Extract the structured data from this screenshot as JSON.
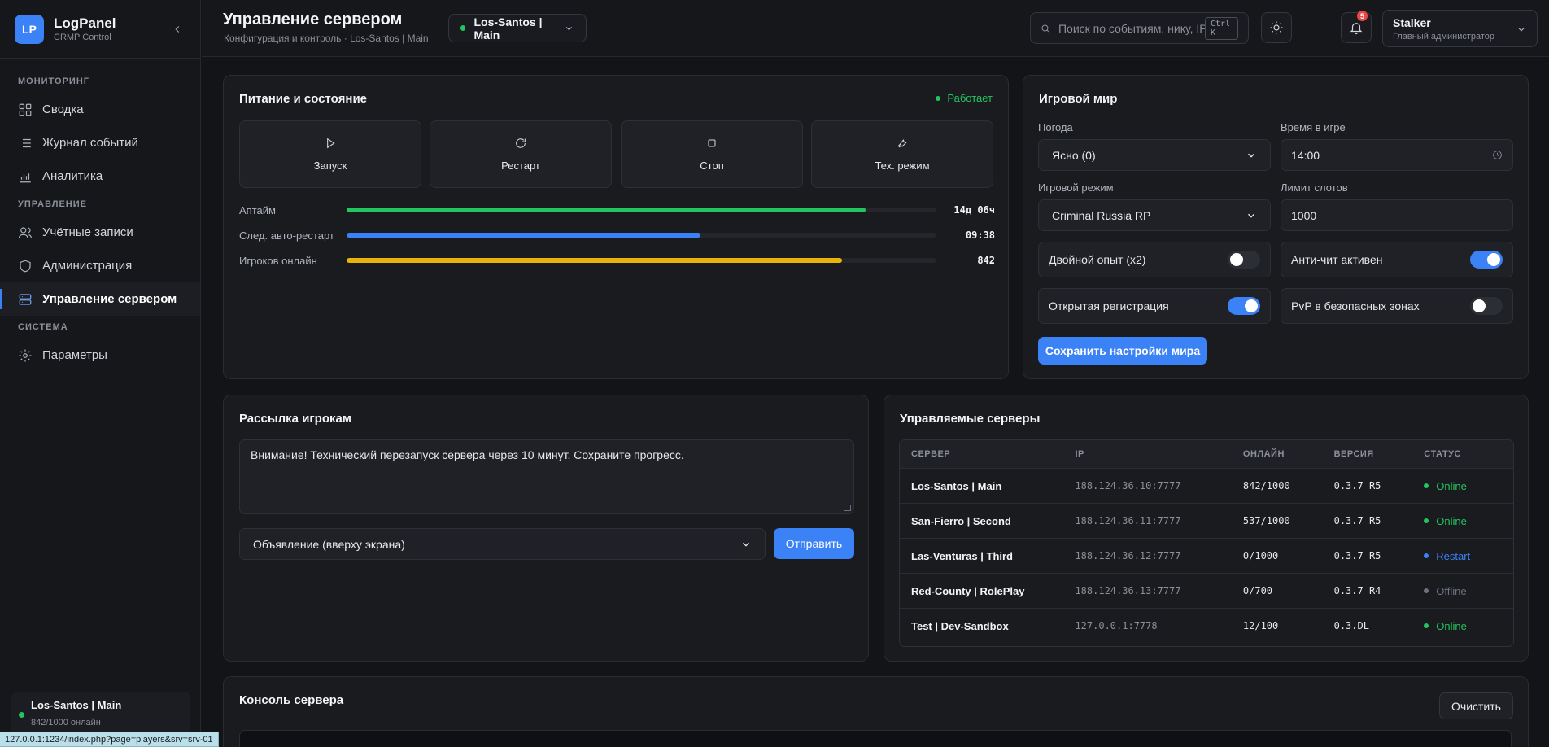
{
  "sidebar": {
    "brand_logo": "LP",
    "brand_title": "LogPanel",
    "brand_sub": "CRMP Control",
    "sections": [
      {
        "title": "МОНИТОРИНГ",
        "items": [
          {
            "label": "Сводка",
            "icon": "grid-icon"
          },
          {
            "label": "Журнал событий",
            "icon": "list-icon"
          },
          {
            "label": "Аналитика",
            "icon": "bar-chart-icon"
          }
        ]
      },
      {
        "title": "УПРАВЛЕНИЕ",
        "items": [
          {
            "label": "Учётные записи",
            "icon": "users-icon"
          },
          {
            "label": "Администрация",
            "icon": "shield-icon"
          },
          {
            "label": "Управление сервером",
            "icon": "server-icon",
            "active": true
          }
        ]
      },
      {
        "title": "СИСТЕМА",
        "items": [
          {
            "label": "Параметры",
            "icon": "gear-icon"
          }
        ]
      }
    ],
    "server_card": {
      "name": "Los-Santos | Main",
      "online": "842/1000 онлайн"
    },
    "status_url": "127.0.0.1:1234/index.php?page=players&srv=srv-01"
  },
  "header": {
    "title": "Управление сервером",
    "subtitle": "Конфигурация и контроль · Los-Santos | Main",
    "server_select": "Los-Santos | Main",
    "search_placeholder": "Поиск по событиям, нику, IP...",
    "search_shortcut": "Ctrl K",
    "notifications_count": "5",
    "user_name": "Stalker",
    "user_role": "Главный администратор"
  },
  "power": {
    "title": "Питание и состояние",
    "status": "Работает",
    "buttons": [
      {
        "label": "Запуск",
        "icon": "play-icon"
      },
      {
        "label": "Рестарт",
        "icon": "refresh-icon"
      },
      {
        "label": "Стоп",
        "icon": "stop-icon"
      },
      {
        "label": "Тех. режим",
        "icon": "wrench-icon"
      }
    ],
    "metrics": [
      {
        "label": "Аптайм",
        "value": "14д 06ч",
        "fraction": 0.88,
        "color": "#22c55e"
      },
      {
        "label": "След. авто-рестарт",
        "value": "09:38",
        "fraction": 0.6,
        "color": "#3b82f6"
      },
      {
        "label": "Игроков онлайн",
        "value": "842",
        "fraction": 0.84,
        "color": "#eab308"
      }
    ]
  },
  "world": {
    "title": "Игровой мир",
    "weather_label": "Погода",
    "weather_value": "Ясно (0)",
    "time_label": "Время в игре",
    "time_value": "14:00",
    "mode_label": "Игровой режим",
    "mode_value": "Criminal Russia RP",
    "slots_label": "Лимит слотов",
    "slots_value": "1000",
    "toggles": [
      {
        "label": "Двойной опыт (x2)",
        "on": false
      },
      {
        "label": "Анти-чит активен",
        "on": true
      },
      {
        "label": "Открытая регистрация",
        "on": true
      },
      {
        "label": "PvP в безопасных зонах",
        "on": false
      }
    ],
    "save_label": "Сохранить настройки мира"
  },
  "broadcast": {
    "title": "Рассылка игрокам",
    "message": "Внимание! Технический перезапуск сервера через 10 минут. Сохраните прогресс.",
    "type_value": "Объявление (вверху экрана)",
    "send_label": "Отправить"
  },
  "servers": {
    "title": "Управляемые серверы",
    "columns": [
      "СЕРВЕР",
      "IP",
      "ОНЛАЙН",
      "ВЕРСИЯ",
      "СТАТУС"
    ],
    "rows": [
      {
        "name": "Los-Santos | Main",
        "ip": "188.124.36.10:7777",
        "online": "842/1000",
        "version": "0.3.7 R5",
        "status": "Online",
        "color": "#22c55e"
      },
      {
        "name": "San-Fierro | Second",
        "ip": "188.124.36.11:7777",
        "online": "537/1000",
        "version": "0.3.7 R5",
        "status": "Online",
        "color": "#22c55e"
      },
      {
        "name": "Las-Venturas | Third",
        "ip": "188.124.36.12:7777",
        "online": "0/1000",
        "version": "0.3.7 R5",
        "status": "Restart",
        "color": "#3b82f6"
      },
      {
        "name": "Red-County | RolePlay",
        "ip": "188.124.36.13:7777",
        "online": "0/700",
        "version": "0.3.7 R4",
        "status": "Offline",
        "color": "#6b7280"
      },
      {
        "name": "Test | Dev-Sandbox",
        "ip": "127.0.0.1:7778",
        "online": "12/100",
        "version": "0.3.DL",
        "status": "Online",
        "color": "#22c55e"
      }
    ]
  },
  "console": {
    "title": "Консоль сервера",
    "clear_label": "Очистить"
  }
}
